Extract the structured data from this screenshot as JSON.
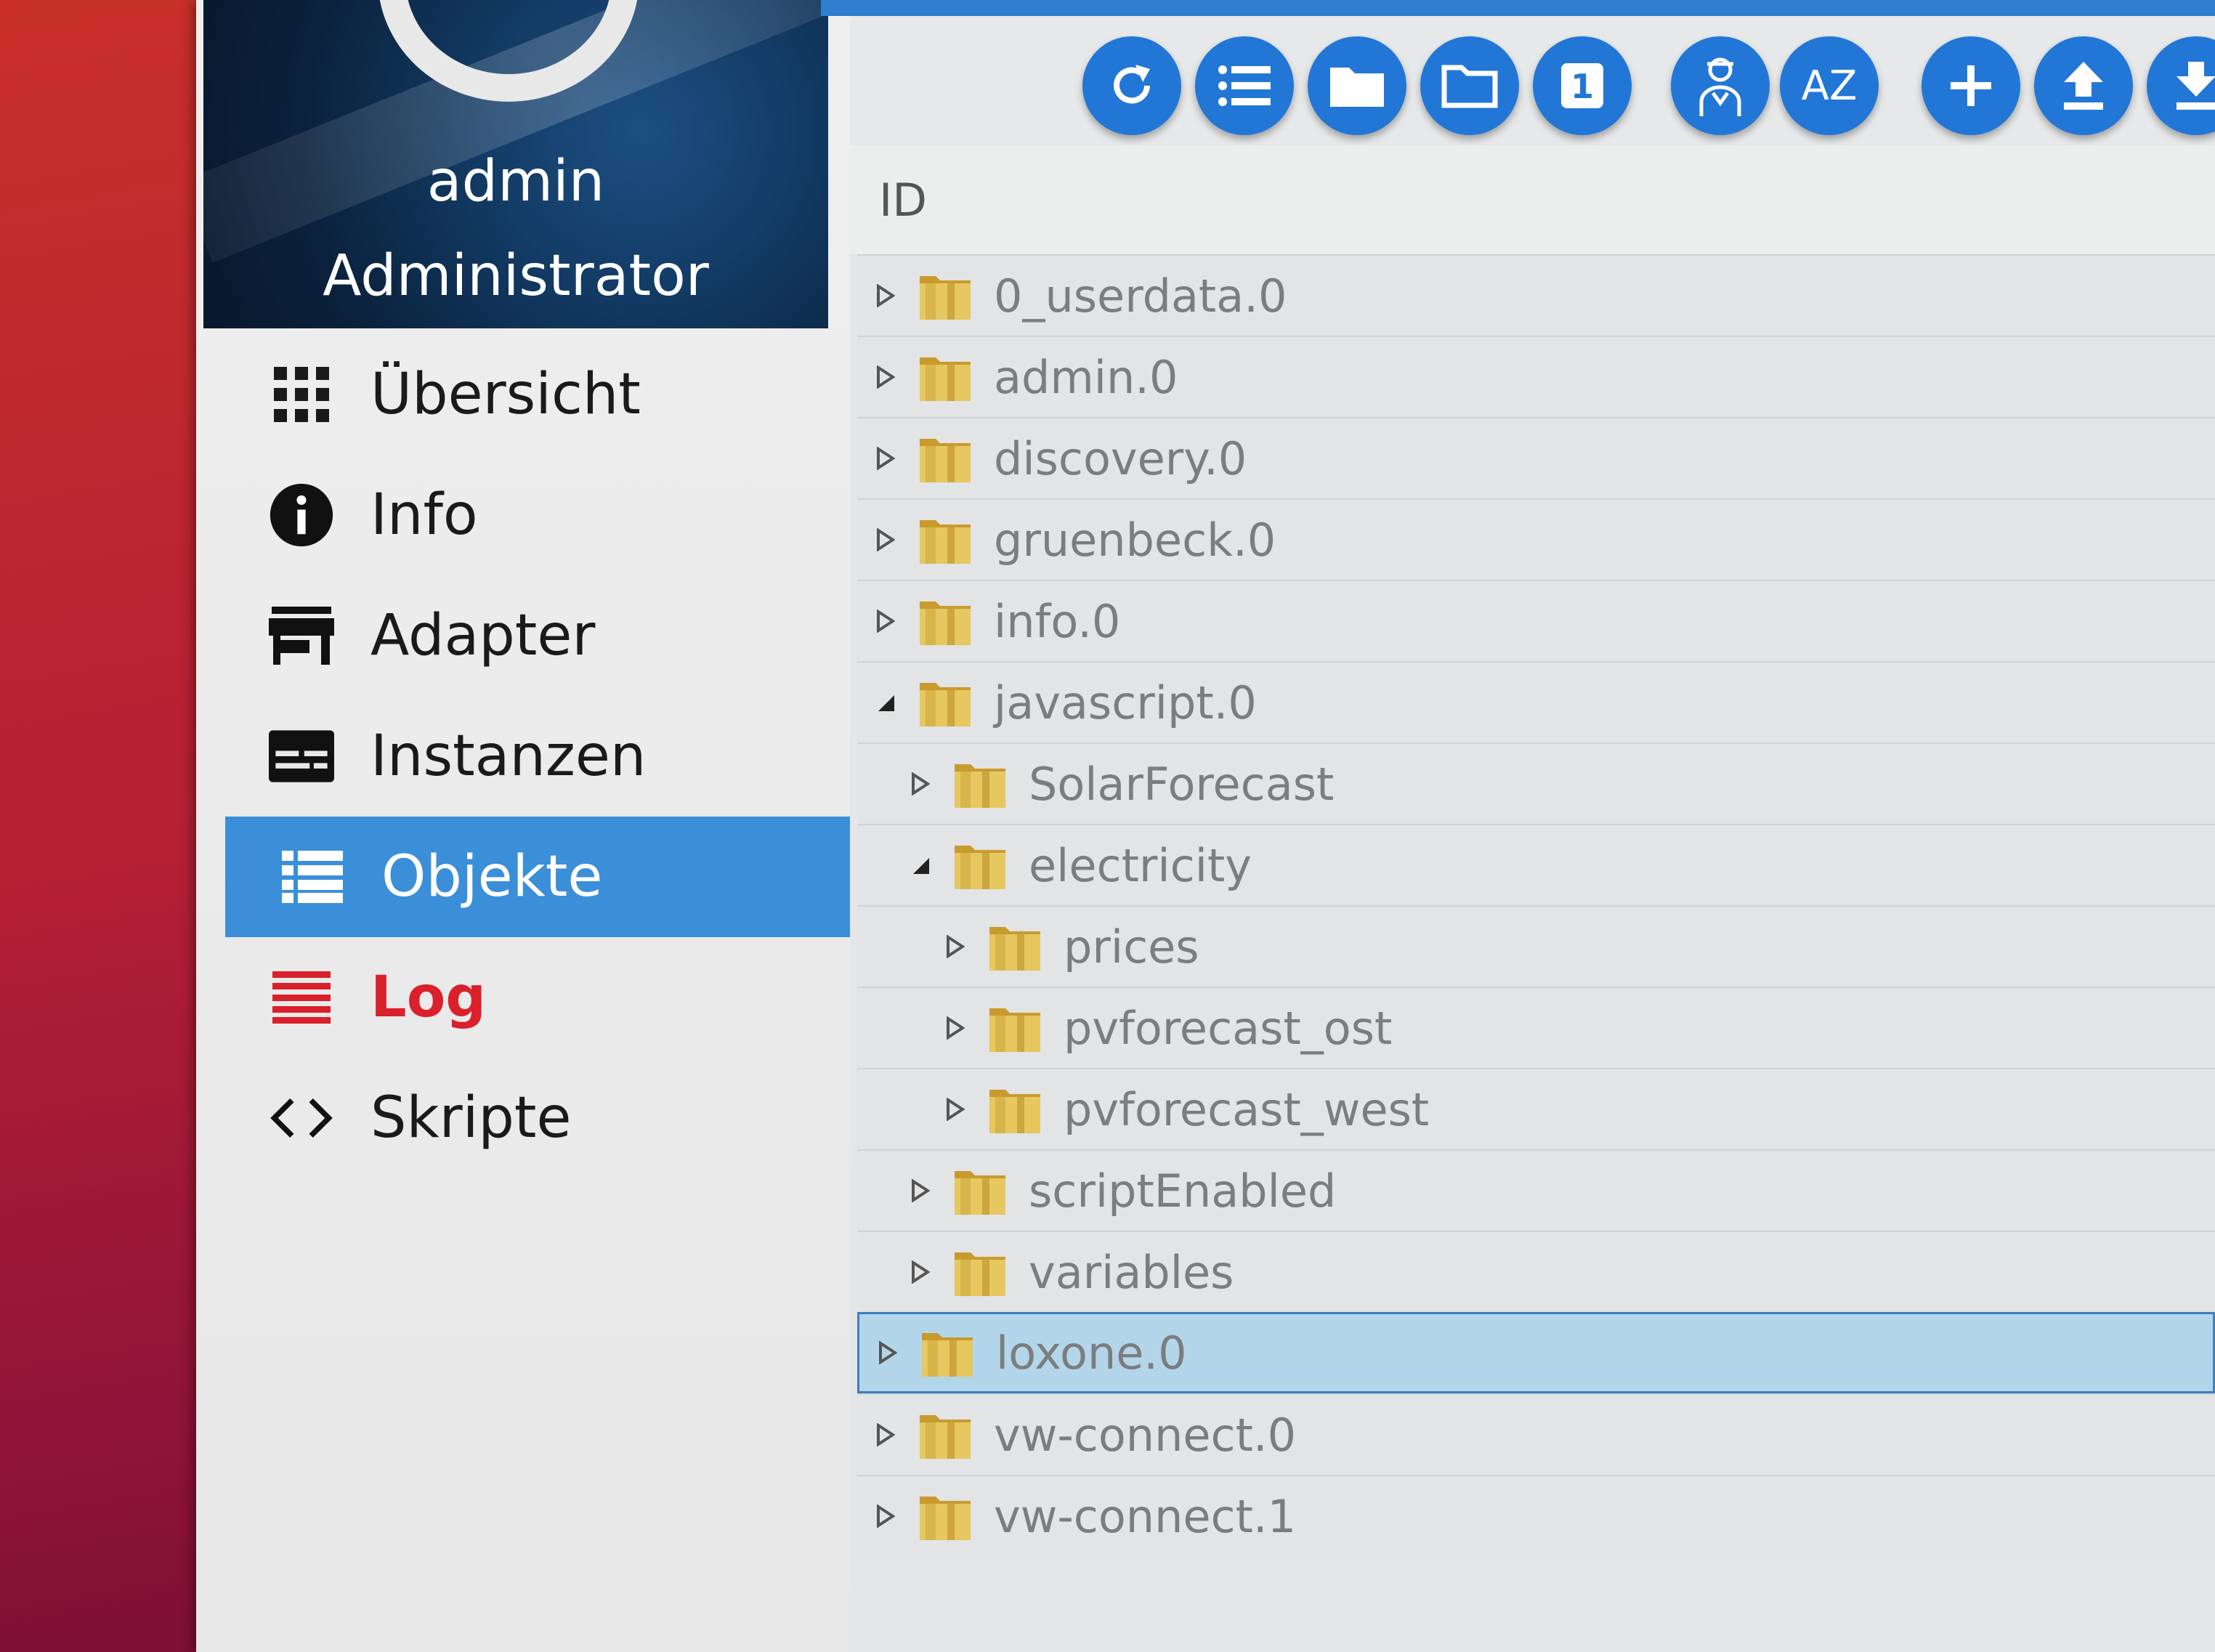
{
  "profile": {
    "name": "admin",
    "role": "Administrator"
  },
  "menu": [
    {
      "label": "Übersicht",
      "icon": "grid-icon"
    },
    {
      "label": "Info",
      "icon": "info-icon"
    },
    {
      "label": "Adapter",
      "icon": "store-icon"
    },
    {
      "label": "Instanzen",
      "icon": "instances-icon"
    },
    {
      "label": "Objekte",
      "icon": "list-icon",
      "active": true
    },
    {
      "label": "Log",
      "icon": "lines-icon",
      "color": "#d9202b"
    },
    {
      "label": "Skripte",
      "icon": "code-icon"
    }
  ],
  "toolbar": {
    "buttons": [
      "refresh-icon",
      "list-icon",
      "folder-filled-icon",
      "folder-outline-icon",
      "number-one-icon",
      "expert-icon",
      "sort-az-icon",
      "add-icon",
      "upload-icon",
      "download-icon"
    ],
    "one_label": "1",
    "az_label": "AZ"
  },
  "table": {
    "id_header": "ID",
    "rows": [
      {
        "label": "0_userdata.0",
        "level": 0,
        "expanded": false
      },
      {
        "label": "admin.0",
        "level": 0,
        "expanded": false
      },
      {
        "label": "discovery.0",
        "level": 0,
        "expanded": false
      },
      {
        "label": "gruenbeck.0",
        "level": 0,
        "expanded": false
      },
      {
        "label": "info.0",
        "level": 0,
        "expanded": false
      },
      {
        "label": "javascript.0",
        "level": 0,
        "expanded": true
      },
      {
        "label": "SolarForecast",
        "level": 1,
        "expanded": false
      },
      {
        "label": "electricity",
        "level": 1,
        "expanded": true
      },
      {
        "label": "prices",
        "level": 2,
        "expanded": false
      },
      {
        "label": "pvforecast_ost",
        "level": 2,
        "expanded": false
      },
      {
        "label": "pvforecast_west",
        "level": 2,
        "expanded": false
      },
      {
        "label": "scriptEnabled",
        "level": 1,
        "expanded": false
      },
      {
        "label": "variables",
        "level": 1,
        "expanded": false
      },
      {
        "label": "loxone.0",
        "level": 0,
        "expanded": false,
        "selected": true
      },
      {
        "label": "vw-connect.0",
        "level": 0,
        "expanded": false
      },
      {
        "label": "vw-connect.1",
        "level": 0,
        "expanded": false
      }
    ]
  },
  "colors": {
    "accent": "#3b8fd8",
    "toolbar_button": "#2277d6",
    "log": "#d9202b",
    "selected_row": "#b3d5ea",
    "folder": "#d8b54a"
  }
}
